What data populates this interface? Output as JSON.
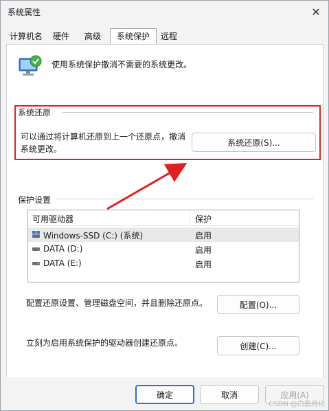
{
  "window": {
    "title": "系统属性"
  },
  "tabs": [
    {
      "label": "计算机名"
    },
    {
      "label": "硬件"
    },
    {
      "label": "高级"
    },
    {
      "label": "系统保护"
    },
    {
      "label": "远程"
    }
  ],
  "intro": {
    "text": "使用系统保护撤消不需要的系统更改。",
    "icon": "system-protection-icon"
  },
  "restore": {
    "section_title": "系统还原",
    "description": "可以通过将计算机还原到上一个还原点，撤消系统更改。",
    "button_label": "系统还原(S)..."
  },
  "protection": {
    "section_title": "保护设置",
    "columns": [
      "可用驱动器",
      "保护"
    ],
    "drives": [
      {
        "name": "Windows-SSD (C:) (系统)",
        "status": "启用",
        "icon": "windows-drive-icon"
      },
      {
        "name": "DATA (D:)",
        "status": "启用",
        "icon": "drive-icon"
      },
      {
        "name": "DATA (E:)",
        "status": "启用",
        "icon": "drive-icon"
      }
    ],
    "configure_text": "配置还原设置、管理磁盘空间，并且删除还原点。",
    "configure_button": "配置(O)...",
    "create_text": "立刻为启用系统保护的驱动器创建还原点。",
    "create_button": "创建(C)..."
  },
  "footer": {
    "ok": "确定",
    "cancel": "取消",
    "apply": "应用(A)"
  },
  "watermark": "CSDN @白鼎月亿",
  "colors": {
    "highlight_border": "#e02020",
    "annotation_arrow": "#e02020",
    "primary_button_border": "#2c6fd1"
  }
}
